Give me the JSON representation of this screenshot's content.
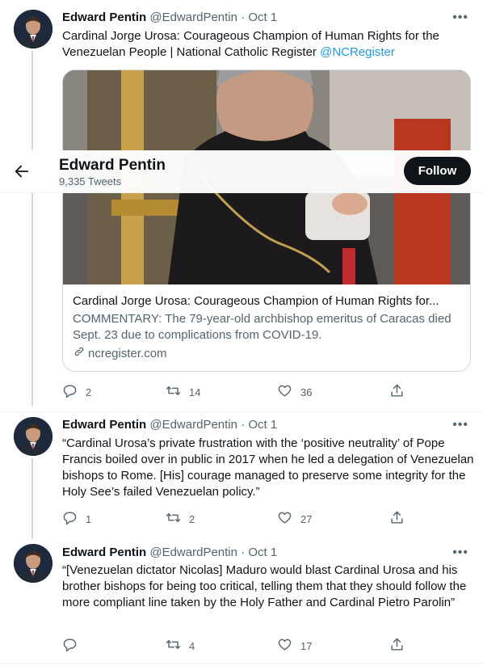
{
  "sticky_header": {
    "profile_name": "Edward Pentin",
    "tweet_count": "9,335 Tweets",
    "follow_label": "Follow"
  },
  "tweets": [
    {
      "author_name": "Edward Pentin",
      "handle": "@EdwardPentin",
      "separator": "·",
      "date": "Oct 1",
      "text": "Cardinal Jorge Urosa: Courageous Champion of Human Rights for the Venezuelan People | National Catholic Register ",
      "mention": "@NCRegister",
      "card": {
        "title": "Cardinal Jorge Urosa: Courageous Champion of Human Rights for...",
        "description": "COMMENTARY: The 79-year-old archbishop emeritus of Caracas died Sept. 23 due to complications from COVID-19.",
        "domain": "ncregister.com"
      },
      "replies": "2",
      "retweets": "14",
      "likes": "36"
    },
    {
      "author_name": "Edward Pentin",
      "handle": "@EdwardPentin",
      "separator": "·",
      "date": "Oct 1",
      "text": "“Cardinal Urosa’s private frustration with the ‘positive neutrality’ of Pope Francis boiled over in public in 2017 when he led a delegation of Venezuelan bishops to Rome. [His] courage managed to preserve some integrity for the Holy See’s failed Venezuelan policy.”",
      "replies": "1",
      "retweets": "2",
      "likes": "27"
    },
    {
      "author_name": "Edward Pentin",
      "handle": "@EdwardPentin",
      "separator": "·",
      "date": "Oct 1",
      "text": "“[Venezuelan dictator Nicolas] Maduro would blast Cardinal Urosa and his brother bishops for being too critical, telling them that they should follow the more compliant line taken by the Holy Father and Cardinal Pietro Parolin”",
      "replies": "",
      "retweets": "4",
      "likes": "17"
    }
  ],
  "icons": {
    "more": "more-horizontal-icon",
    "reply": "reply-icon",
    "retweet": "retweet-icon",
    "like": "heart-icon",
    "share": "share-icon",
    "link": "link-icon",
    "back": "back-arrow-icon"
  },
  "colors": {
    "link": "#1d9bf0",
    "secondary_text": "#536471",
    "follow_button": "#0f1419",
    "border": "#cfd9de"
  }
}
